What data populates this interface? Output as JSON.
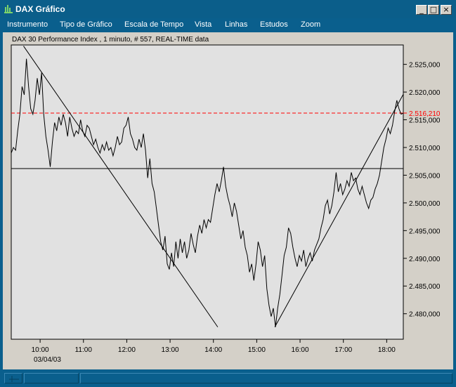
{
  "window": {
    "title": "DAX Gráfico",
    "minimize_glyph": "_",
    "maximize_glyph": "□",
    "close_glyph": "×"
  },
  "menu": [
    "Instrumento",
    "Tipo de Gráfico",
    "Escala de Tempo",
    "Vista",
    "Linhas",
    "Estudos",
    "Zoom"
  ],
  "chart_data": {
    "type": "line",
    "title": "DAX 30 Performance Index , 1 minuto, # 557, REAL-TIME data",
    "xlabel": "",
    "ylabel": "",
    "x_ticks": [
      "10:00",
      "11:00",
      "12:00",
      "13:00",
      "14:00",
      "15:00",
      "16:00",
      "17:00",
      "18:00"
    ],
    "x_date_label": "03/04/03",
    "xlim": [
      "09:20",
      "18:23"
    ],
    "y_ticks": [
      "2.525,000",
      "2.520,000",
      "2.515,000",
      "2.510,000",
      "2.505,000",
      "2.500,000",
      "2.495,000",
      "2.490,000",
      "2.485,000",
      "2.480,000"
    ],
    "y_tick_values": [
      2525,
      2520,
      2515,
      2510,
      2505,
      2500,
      2495,
      2490,
      2485,
      2480
    ],
    "ylim": [
      2475.4,
      2528.5
    ],
    "current_price_label": "2.516,210",
    "current_price": 2516.21,
    "reference_level": 2506.2,
    "trend_lines": [
      {
        "from": [
          "09:37",
          2528.3
        ],
        "to": [
          "14:06",
          2477.6
        ]
      },
      {
        "from": [
          "15:25",
          2477.6
        ],
        "to": [
          "18:23",
          2519.6
        ]
      }
    ],
    "series": [
      {
        "points": [
          [
            "09:20",
            2509.0
          ],
          [
            "09:23",
            2510.0
          ],
          [
            "09:26",
            2509.5
          ],
          [
            "09:29",
            2513.0
          ],
          [
            "09:32",
            2516.0
          ],
          [
            "09:35",
            2521.0
          ],
          [
            "09:38",
            2519.5
          ],
          [
            "09:41",
            2526.0
          ],
          [
            "09:44",
            2521.0
          ],
          [
            "09:47",
            2517.0
          ],
          [
            "09:50",
            2516.0
          ],
          [
            "09:53",
            2518.5
          ],
          [
            "09:56",
            2522.5
          ],
          [
            "09:59",
            2519.5
          ],
          [
            "10:02",
            2523.5
          ],
          [
            "10:05",
            2516.0
          ],
          [
            "10:08",
            2512.0
          ],
          [
            "10:11",
            2509.5
          ],
          [
            "10:14",
            2506.5
          ],
          [
            "10:17",
            2511.0
          ],
          [
            "10:20",
            2514.5
          ],
          [
            "10:23",
            2513.0
          ],
          [
            "10:26",
            2515.5
          ],
          [
            "10:29",
            2514.0
          ],
          [
            "10:32",
            2516.0
          ],
          [
            "10:35",
            2514.5
          ],
          [
            "10:38",
            2512.0
          ],
          [
            "10:41",
            2515.5
          ],
          [
            "10:44",
            2513.5
          ],
          [
            "10:47",
            2512.0
          ],
          [
            "10:50",
            2513.0
          ],
          [
            "10:53",
            2512.5
          ],
          [
            "10:56",
            2515.0
          ],
          [
            "10:59",
            2513.0
          ],
          [
            "11:02",
            2512.0
          ],
          [
            "11:05",
            2514.0
          ],
          [
            "11:08",
            2513.5
          ],
          [
            "11:11",
            2512.0
          ],
          [
            "11:14",
            2510.5
          ],
          [
            "11:17",
            2511.5
          ],
          [
            "11:20",
            2510.0
          ],
          [
            "11:23",
            2509.0
          ],
          [
            "11:26",
            2510.5
          ],
          [
            "11:29",
            2509.5
          ],
          [
            "11:32",
            2511.0
          ],
          [
            "11:35",
            2509.5
          ],
          [
            "11:38",
            2510.0
          ],
          [
            "11:41",
            2508.5
          ],
          [
            "11:44",
            2510.0
          ],
          [
            "11:47",
            2512.0
          ],
          [
            "11:50",
            2510.5
          ],
          [
            "11:53",
            2511.0
          ],
          [
            "11:56",
            2513.5
          ],
          [
            "11:59",
            2514.0
          ],
          [
            "12:02",
            2515.5
          ],
          [
            "12:05",
            2512.5
          ],
          [
            "12:08",
            2511.5
          ],
          [
            "12:11",
            2510.0
          ],
          [
            "12:14",
            2509.5
          ],
          [
            "12:17",
            2511.5
          ],
          [
            "12:20",
            2510.0
          ],
          [
            "12:23",
            2512.5
          ],
          [
            "12:26",
            2509.5
          ],
          [
            "12:29",
            2504.5
          ],
          [
            "12:32",
            2508.0
          ],
          [
            "12:35",
            2503.5
          ],
          [
            "12:38",
            2502.0
          ],
          [
            "12:41",
            2499.0
          ],
          [
            "12:44",
            2496.0
          ],
          [
            "12:47",
            2493.0
          ],
          [
            "12:50",
            2491.5
          ],
          [
            "12:53",
            2494.0
          ],
          [
            "12:56",
            2489.0
          ],
          [
            "12:59",
            2488.0
          ],
          [
            "13:02",
            2491.0
          ],
          [
            "13:05",
            2488.5
          ],
          [
            "13:08",
            2493.0
          ],
          [
            "13:11",
            2490.0
          ],
          [
            "13:14",
            2493.5
          ],
          [
            "13:17",
            2491.0
          ],
          [
            "13:20",
            2493.0
          ],
          [
            "13:23",
            2490.0
          ],
          [
            "13:26",
            2491.5
          ],
          [
            "13:29",
            2494.5
          ],
          [
            "13:32",
            2492.5
          ],
          [
            "13:35",
            2491.0
          ],
          [
            "13:38",
            2494.0
          ],
          [
            "13:41",
            2496.0
          ],
          [
            "13:44",
            2494.5
          ],
          [
            "13:47",
            2497.0
          ],
          [
            "13:50",
            2495.5
          ],
          [
            "13:53",
            2497.0
          ],
          [
            "13:56",
            2496.5
          ],
          [
            "13:59",
            2499.0
          ],
          [
            "14:02",
            2501.5
          ],
          [
            "14:05",
            2503.5
          ],
          [
            "14:08",
            2502.0
          ],
          [
            "14:11",
            2504.0
          ],
          [
            "14:14",
            2506.5
          ],
          [
            "14:17",
            2503.0
          ],
          [
            "14:20",
            2501.0
          ],
          [
            "14:23",
            2499.5
          ],
          [
            "14:26",
            2497.5
          ],
          [
            "14:29",
            2500.0
          ],
          [
            "14:32",
            2498.5
          ],
          [
            "14:35",
            2496.0
          ],
          [
            "14:38",
            2493.5
          ],
          [
            "14:41",
            2495.0
          ],
          [
            "14:44",
            2492.0
          ],
          [
            "14:47",
            2490.5
          ],
          [
            "14:50",
            2487.5
          ],
          [
            "14:53",
            2489.0
          ],
          [
            "14:56",
            2486.0
          ],
          [
            "14:59",
            2489.0
          ],
          [
            "15:02",
            2493.0
          ],
          [
            "15:05",
            2491.5
          ],
          [
            "15:08",
            2488.5
          ],
          [
            "15:11",
            2490.5
          ],
          [
            "15:14",
            2484.5
          ],
          [
            "15:17",
            2481.5
          ],
          [
            "15:20",
            2479.5
          ],
          [
            "15:23",
            2481.0
          ],
          [
            "15:26",
            2477.6
          ],
          [
            "15:29",
            2481.0
          ],
          [
            "15:32",
            2483.5
          ],
          [
            "15:35",
            2487.0
          ],
          [
            "15:38",
            2490.5
          ],
          [
            "15:41",
            2492.0
          ],
          [
            "15:44",
            2495.5
          ],
          [
            "15:47",
            2494.5
          ],
          [
            "15:50",
            2492.0
          ],
          [
            "15:53",
            2490.0
          ],
          [
            "15:56",
            2488.5
          ],
          [
            "15:59",
            2490.5
          ],
          [
            "16:02",
            2489.5
          ],
          [
            "16:05",
            2491.5
          ],
          [
            "16:08",
            2488.5
          ],
          [
            "16:11",
            2490.0
          ],
          [
            "16:14",
            2491.0
          ],
          [
            "16:17",
            2489.5
          ],
          [
            "16:20",
            2491.5
          ],
          [
            "16:23",
            2492.5
          ],
          [
            "16:26",
            2493.5
          ],
          [
            "16:29",
            2495.5
          ],
          [
            "16:32",
            2497.0
          ],
          [
            "16:35",
            2499.5
          ],
          [
            "16:38",
            2500.5
          ],
          [
            "16:41",
            2498.0
          ],
          [
            "16:44",
            2499.5
          ],
          [
            "16:47",
            2502.0
          ],
          [
            "16:50",
            2505.5
          ],
          [
            "16:53",
            2502.0
          ],
          [
            "16:56",
            2503.5
          ],
          [
            "16:59",
            2501.5
          ],
          [
            "17:02",
            2502.5
          ],
          [
            "17:05",
            2504.0
          ],
          [
            "17:08",
            2503.0
          ],
          [
            "17:11",
            2505.5
          ],
          [
            "17:14",
            2504.0
          ],
          [
            "17:17",
            2504.5
          ],
          [
            "17:20",
            2502.5
          ],
          [
            "17:23",
            2501.5
          ],
          [
            "17:26",
            2503.0
          ],
          [
            "17:29",
            2501.5
          ],
          [
            "17:32",
            2500.0
          ],
          [
            "17:35",
            2499.0
          ],
          [
            "17:38",
            2500.5
          ],
          [
            "17:41",
            2501.0
          ],
          [
            "17:44",
            2502.5
          ],
          [
            "17:47",
            2503.5
          ],
          [
            "17:50",
            2505.0
          ],
          [
            "17:53",
            2507.5
          ],
          [
            "17:56",
            2510.0
          ],
          [
            "17:59",
            2511.5
          ],
          [
            "18:02",
            2513.5
          ],
          [
            "18:05",
            2512.5
          ],
          [
            "18:08",
            2514.0
          ],
          [
            "18:11",
            2516.5
          ],
          [
            "18:14",
            2518.5
          ],
          [
            "18:17",
            2517.0
          ],
          [
            "18:20",
            2516.0
          ],
          [
            "18:23",
            2516.2
          ]
        ]
      }
    ],
    "colors": {
      "price_line": "#000000",
      "current_price": "#ff0000",
      "plot_bg": "#e1e1e1"
    }
  }
}
